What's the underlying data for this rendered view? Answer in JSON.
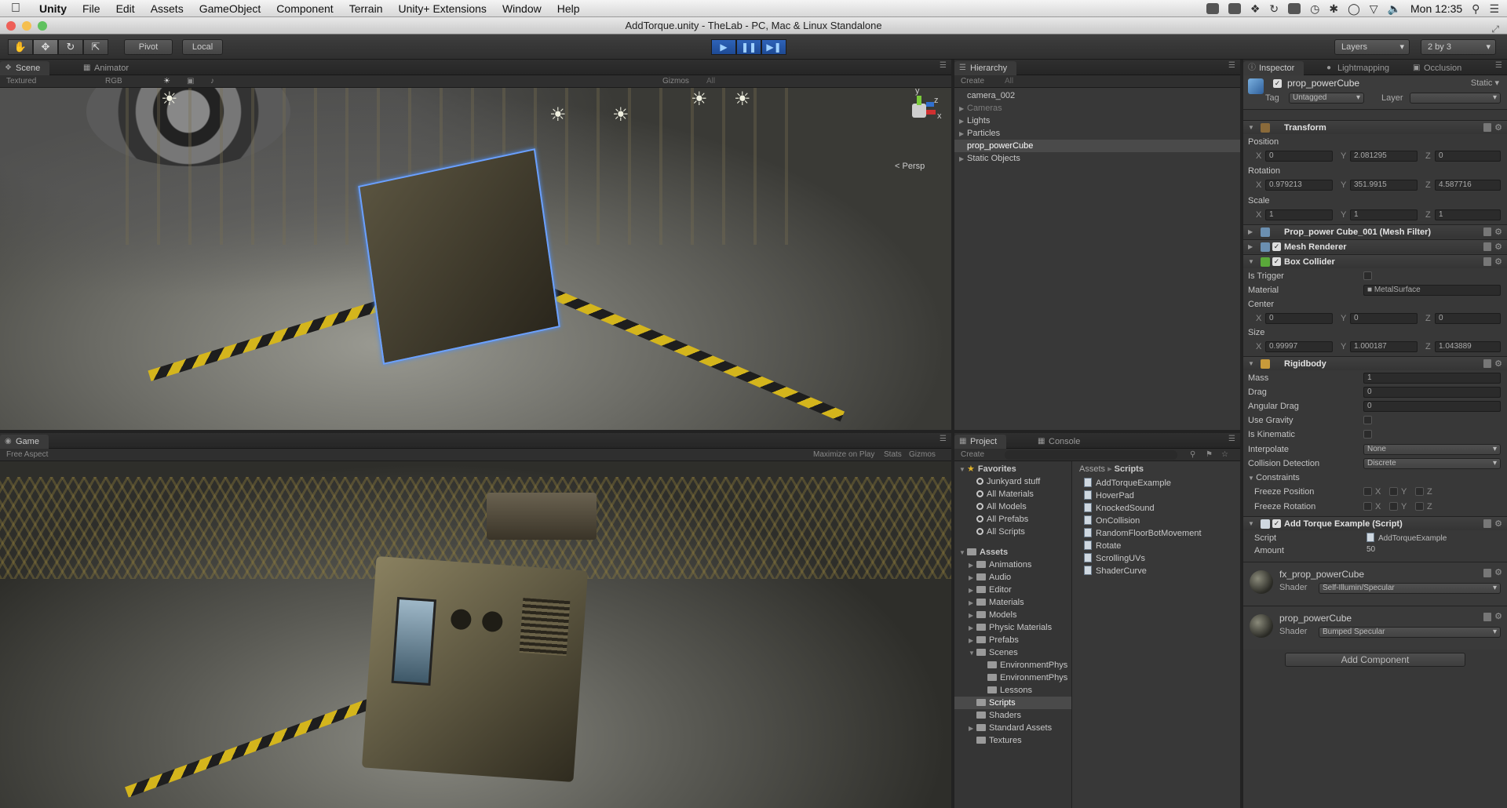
{
  "menubar": {
    "app": "Unity",
    "items": [
      "File",
      "Edit",
      "Assets",
      "GameObject",
      "Component",
      "Terrain",
      "Unity+ Extensions",
      "Window",
      "Help"
    ],
    "clock": "Mon 12:35"
  },
  "window": {
    "title": "AddTorque.unity - TheLab - PC, Mac & Linux Standalone"
  },
  "toolbar": {
    "pivot": "Pivot",
    "local": "Local",
    "layers": "Layers",
    "layout": "2 by 3"
  },
  "scene": {
    "tabs": [
      "Scene",
      "Animator"
    ],
    "render_mode": "Textured",
    "color_mode": "RGB",
    "gizmos": "Gizmos",
    "search": "All",
    "persp": "Persp",
    "axes": {
      "x": "x",
      "y": "y",
      "z": "z"
    }
  },
  "game": {
    "tab": "Game",
    "aspect": "Free Aspect",
    "maximize": "Maximize on Play",
    "stats": "Stats",
    "gizmos": "Gizmos"
  },
  "hierarchy": {
    "tab": "Hierarchy",
    "create": "Create",
    "search": "All",
    "items": [
      {
        "label": "camera_002",
        "dim": false,
        "fold": false
      },
      {
        "label": "Cameras",
        "dim": true,
        "fold": true
      },
      {
        "label": "Lights",
        "dim": false,
        "fold": true
      },
      {
        "label": "Particles",
        "dim": false,
        "fold": true
      },
      {
        "label": "prop_powerCube",
        "dim": false,
        "fold": false,
        "selected": true
      },
      {
        "label": "Static Objects",
        "dim": false,
        "fold": true
      }
    ]
  },
  "project": {
    "tabs": [
      "Project",
      "Console"
    ],
    "create": "Create",
    "favorites_label": "Favorites",
    "favorites": [
      "Junkyard stuff",
      "All Materials",
      "All Models",
      "All Prefabs",
      "All Scripts"
    ],
    "assets_label": "Assets",
    "assets": [
      "Animations",
      "Audio",
      "Editor",
      "Materials",
      "Models",
      "Physic Materials",
      "Prefabs",
      "Scenes"
    ],
    "scene_children": [
      "EnvironmentPhys",
      "EnvironmentPhys",
      "Lessons"
    ],
    "assets_after": [
      "Scripts",
      "Shaders",
      "Standard Assets",
      "Textures"
    ],
    "breadcrumb": [
      "Assets",
      "Scripts"
    ],
    "scripts": [
      "AddTorqueExample",
      "HoverPad",
      "KnockedSound",
      "OnCollision",
      "RandomFloorBotMovement",
      "Rotate",
      "ScrollingUVs",
      "ShaderCurve"
    ]
  },
  "inspector": {
    "tabs": [
      "Inspector",
      "Lightmapping",
      "Occlusion"
    ],
    "object_name": "prop_powerCube",
    "static": "Static",
    "tag_label": "Tag",
    "tag_value": "Untagged",
    "layer_label": "Layer",
    "layer_value": "",
    "transform": {
      "title": "Transform",
      "position_label": "Position",
      "position": [
        "0",
        "2.081295",
        "0"
      ],
      "rotation_label": "Rotation",
      "rotation": [
        "0.979213",
        "351.9915",
        "4.587716"
      ],
      "scale_label": "Scale",
      "scale": [
        "1",
        "1",
        "1"
      ]
    },
    "mesh_filter": "Prop_power Cube_001 (Mesh Filter)",
    "mesh_renderer": "Mesh Renderer",
    "box_collider": {
      "title": "Box Collider",
      "is_trigger": "Is Trigger",
      "material_label": "Material",
      "material": "MetalSurface",
      "center_label": "Center",
      "center": [
        "0",
        "0",
        "0"
      ],
      "size_label": "Size",
      "size": [
        "0.99997",
        "1.000187",
        "1.043889"
      ]
    },
    "rigidbody": {
      "title": "Rigidbody",
      "mass_label": "Mass",
      "mass": "1",
      "drag_label": "Drag",
      "drag": "0",
      "angular_drag_label": "Angular Drag",
      "angular_drag": "0",
      "use_gravity": "Use Gravity",
      "is_kinematic": "Is Kinematic",
      "interpolate_label": "Interpolate",
      "interpolate": "None",
      "collision_label": "Collision Detection",
      "collision": "Discrete",
      "constraints": "Constraints",
      "freeze_position": "Freeze Position",
      "freeze_rotation": "Freeze Rotation"
    },
    "add_torque": {
      "title": "Add Torque Example (Script)",
      "script_label": "Script",
      "script": "AddTorqueExample",
      "amount_label": "Amount",
      "amount": "50"
    },
    "materials": [
      {
        "name": "fx_prop_powerCube",
        "shader_label": "Shader",
        "shader": "Self-Illumin/Specular"
      },
      {
        "name": "prop_powerCube",
        "shader_label": "Shader",
        "shader": "Bumped Specular"
      }
    ],
    "add_component": "Add Component",
    "axis_x": "X",
    "axis_y": "Y",
    "axis_z": "Z"
  }
}
